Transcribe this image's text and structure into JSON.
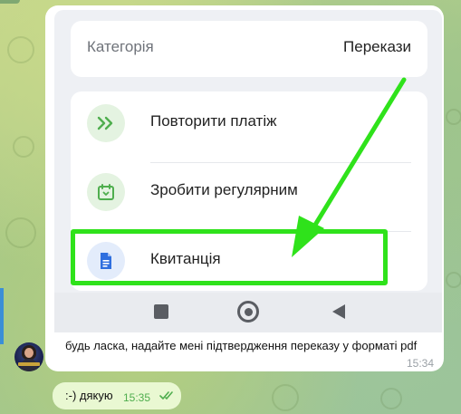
{
  "photo": {
    "category_label": "Категорія",
    "category_value": "Перекази",
    "actions": [
      {
        "label": "Повторити платіж",
        "icon": "double-chevron-right-icon"
      },
      {
        "label": "Зробити регулярним",
        "icon": "calendar-repeat-icon"
      },
      {
        "label": "Квитанція",
        "icon": "document-icon"
      }
    ],
    "navbar": [
      "square-recents-icon",
      "home-circle-icon",
      "back-triangle-icon"
    ]
  },
  "message": {
    "caption": "будь ласка, надайте мені підтвердження переказу у форматі pdf",
    "time": "15:34"
  },
  "reply": {
    "text": ":-) дякую",
    "time": "15:35"
  },
  "colors": {
    "highlight": "#2fe21b",
    "accent_green": "#4fae4e",
    "doc_blue": "#2f6fdf"
  }
}
